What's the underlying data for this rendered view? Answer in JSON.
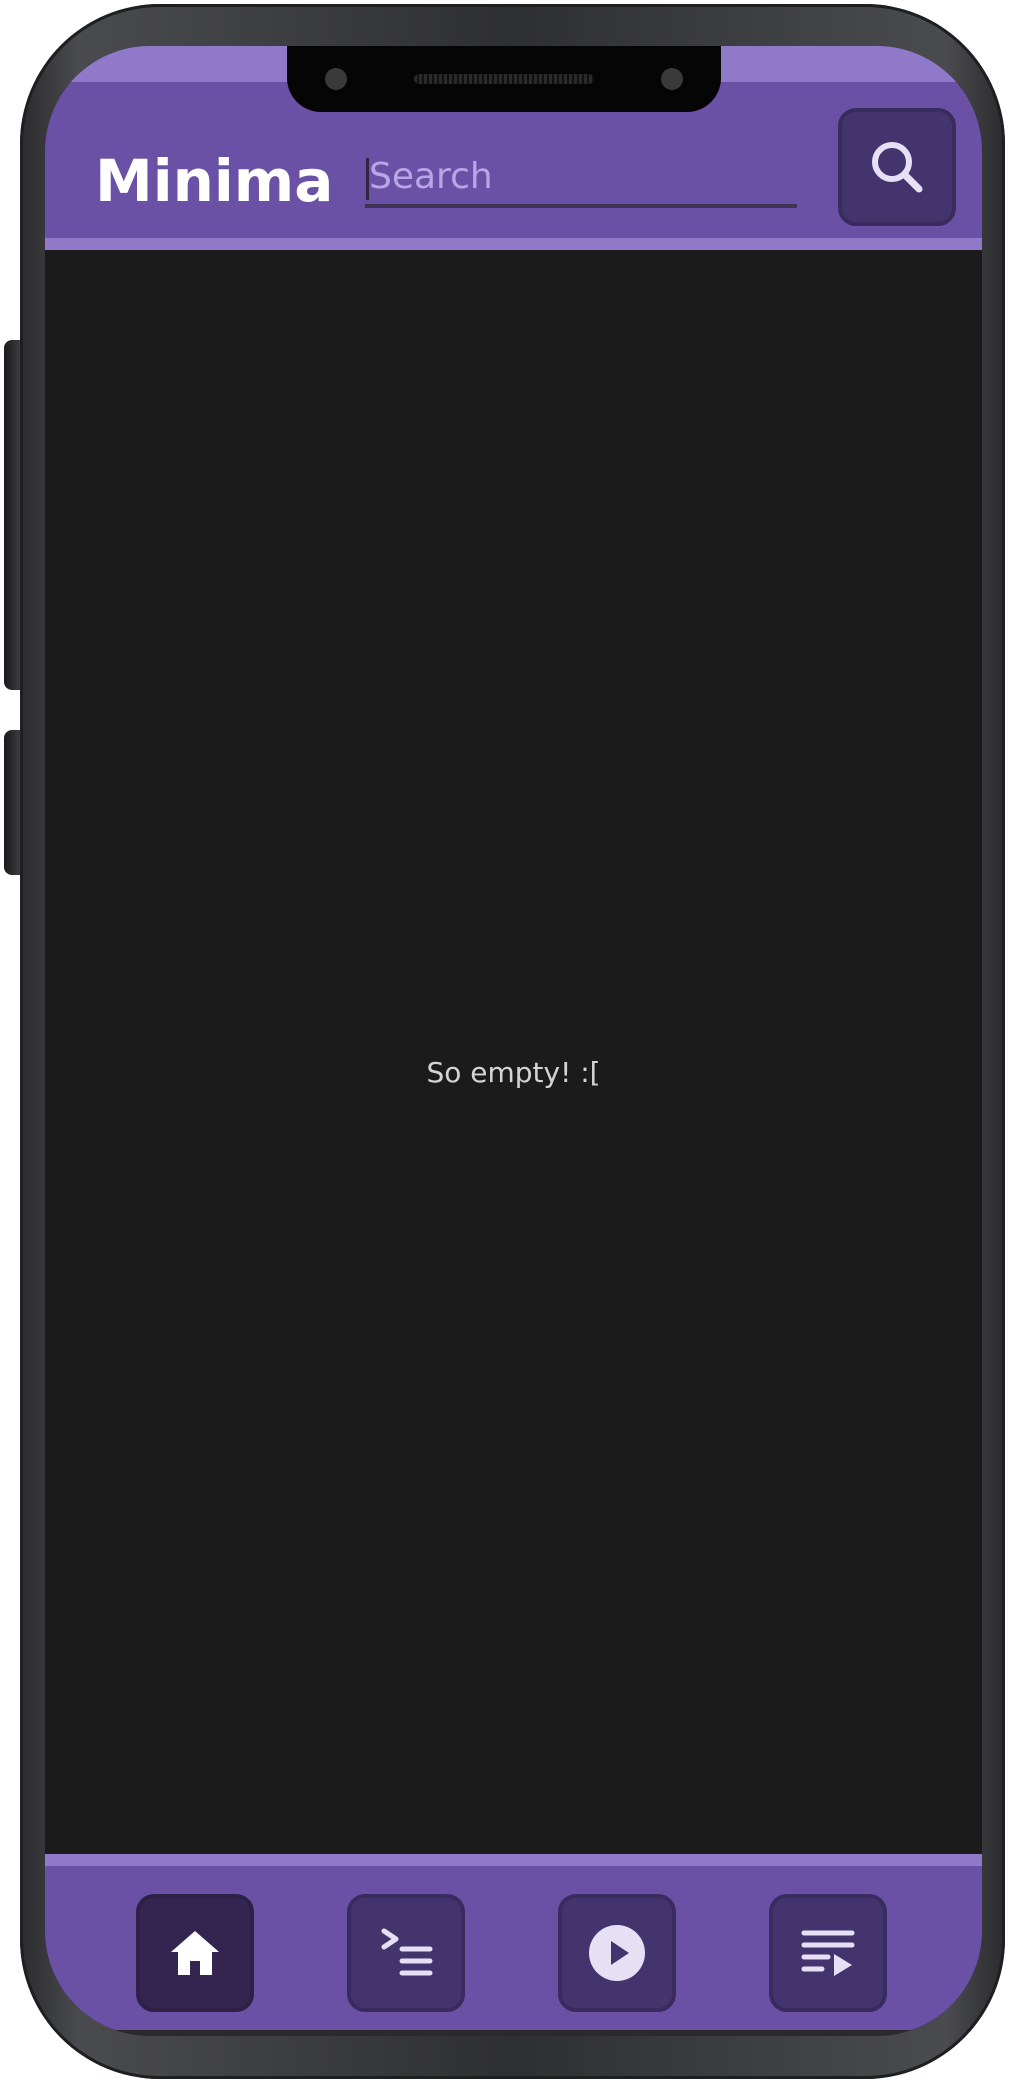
{
  "app": {
    "title": "Minima"
  },
  "search": {
    "placeholder": "Search",
    "value": "",
    "button_icon": "search-icon"
  },
  "main": {
    "empty_message": "So empty! :["
  },
  "nav": {
    "items": [
      {
        "icon": "home-icon",
        "active": true
      },
      {
        "icon": "queue-icon",
        "active": false
      },
      {
        "icon": "play-circle-icon",
        "active": false
      },
      {
        "icon": "playlist-play-icon",
        "active": false
      }
    ]
  },
  "colors": {
    "accent": "#6a51a6",
    "accent_light": "#8f79c8",
    "button": "#44346e",
    "button_active": "#33254f",
    "background": "#1b1b1b"
  }
}
